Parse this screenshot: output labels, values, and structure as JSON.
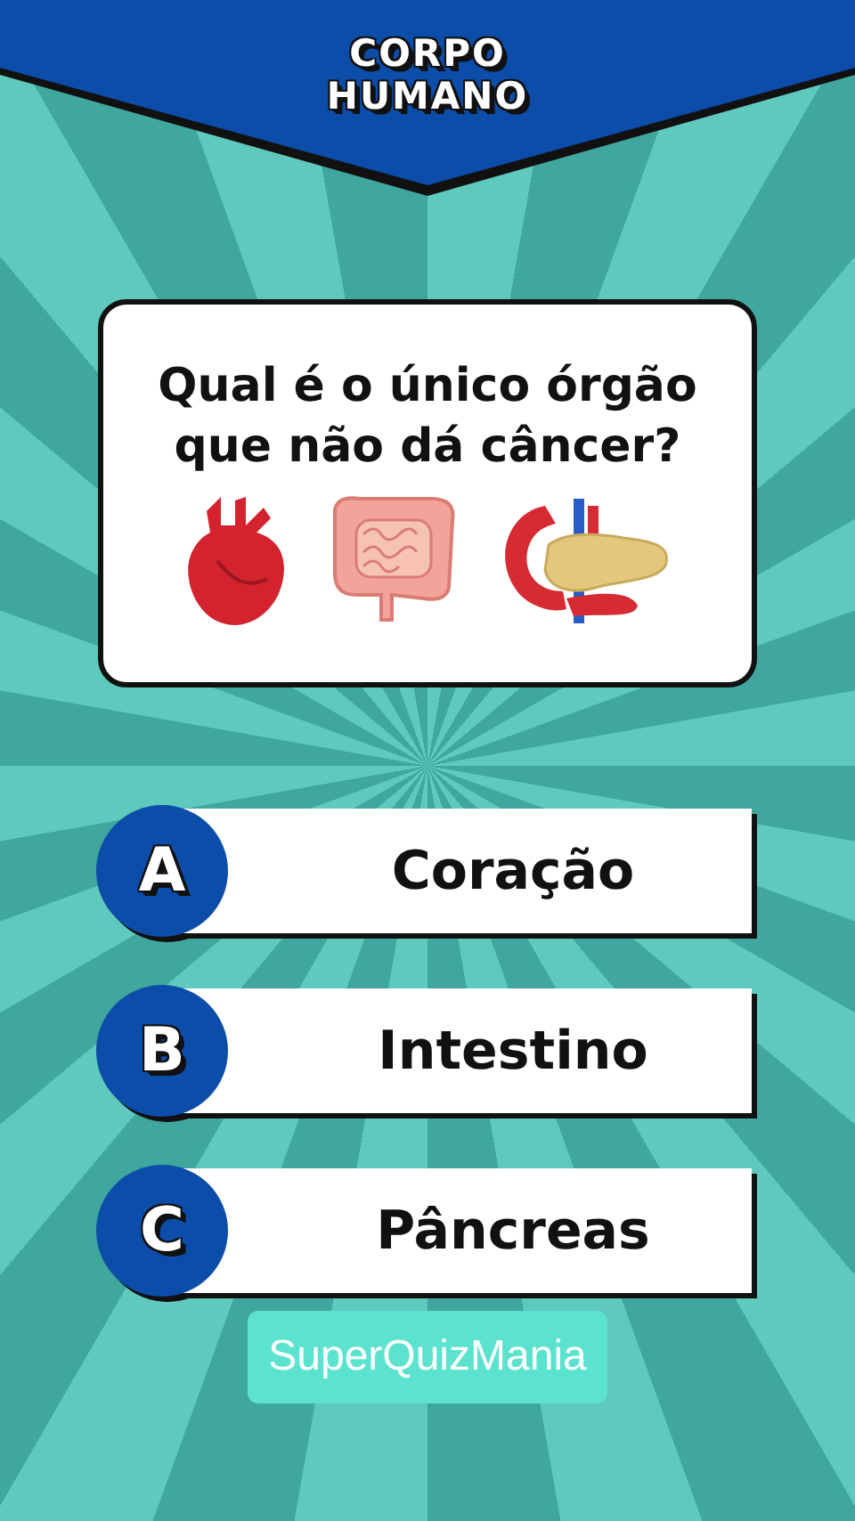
{
  "header": {
    "title_lines": [
      "CORPO",
      "HUMANO"
    ]
  },
  "question": {
    "text": "Qual é o único órgão que não dá câncer?"
  },
  "options": [
    {
      "letter": "A",
      "label": "Coração"
    },
    {
      "letter": "B",
      "label": "Intestino"
    },
    {
      "letter": "C",
      "label": "Pâncreas"
    }
  ],
  "brand": "SuperQuizMania"
}
